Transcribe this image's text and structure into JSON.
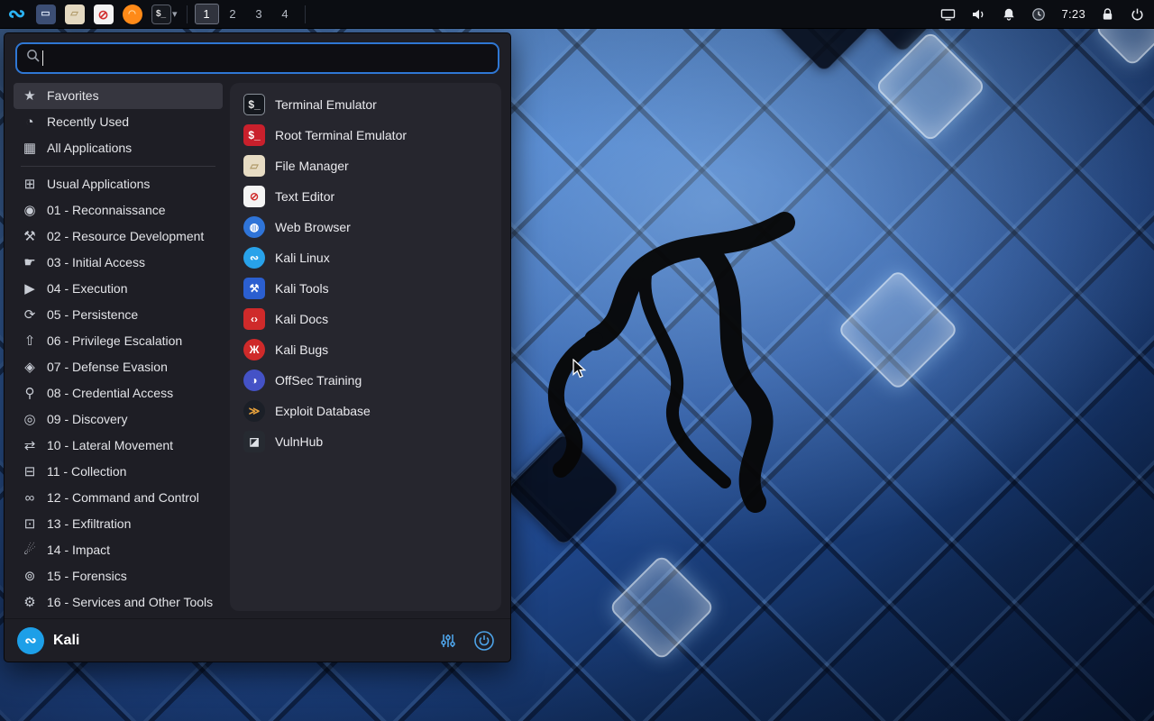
{
  "colors": {
    "accent": "#2f77d4",
    "panel_bg": "#0b0d12",
    "menu_bg": "#1e1e25",
    "kali_blue": "#1d9fe8"
  },
  "panel": {
    "launchers": [
      {
        "name": "whisker-menu-button",
        "glyph": "∾",
        "fg": "#2bb3f3",
        "size": "24px"
      },
      {
        "name": "window-manager-launcher",
        "glyph": "▭",
        "bg": "#3c4e74",
        "fg": "#d6e0f2",
        "size": "11px"
      },
      {
        "name": "file-manager-launcher",
        "glyph": "▱",
        "bg": "#e4d9c1",
        "fg": "#b29c6c",
        "size": "11px"
      },
      {
        "name": "text-editor-launcher",
        "glyph": "⊘",
        "bg": "#f3f3f3",
        "fg": "#d22f2f",
        "size": "14px"
      },
      {
        "name": "firefox-launcher",
        "glyph": "◠",
        "bg": "#ff8a18",
        "fg": "#ffd9a0",
        "size": "10px",
        "shape": "circle"
      },
      {
        "name": "terminal-launcher",
        "glyph": "$_",
        "bg": "#16191f",
        "fg": "#e4e4e4",
        "size": "10px",
        "border": "1px solid #5a5f6a"
      }
    ],
    "dropdown_glyph": "▾",
    "workspaces": [
      {
        "label": "1",
        "active": true
      },
      {
        "label": "2"
      },
      {
        "label": "3"
      },
      {
        "label": "4"
      }
    ],
    "tray_icons": [
      "display-icon",
      "volume-icon",
      "notifications-icon",
      "status-icon",
      "lock-icon",
      "logout-icon"
    ],
    "clock": "7:23"
  },
  "menu": {
    "search": {
      "value": "",
      "placeholder": ""
    },
    "categories": [
      {
        "label": "Favorites",
        "glyph": "★",
        "active": true
      },
      {
        "label": "Recently Used",
        "glyph": "◔"
      },
      {
        "label": "All Applications",
        "glyph": "▦"
      },
      {
        "divider": true
      },
      {
        "label": "Usual Applications",
        "glyph": "⊞"
      },
      {
        "label": "01 - Reconnaissance",
        "glyph": "◉"
      },
      {
        "label": "02 - Resource Development",
        "glyph": "⚒"
      },
      {
        "label": "03 - Initial Access",
        "glyph": "☛"
      },
      {
        "label": "04 - Execution",
        "glyph": "▶"
      },
      {
        "label": "05 - Persistence",
        "glyph": "⟳"
      },
      {
        "label": "06 - Privilege Escalation",
        "glyph": "⇧"
      },
      {
        "label": "07 - Defense Evasion",
        "glyph": "◈"
      },
      {
        "label": "08 - Credential Access",
        "glyph": "⚲"
      },
      {
        "label": "09 - Discovery",
        "glyph": "◎"
      },
      {
        "label": "10 - Lateral Movement",
        "glyph": "⇄"
      },
      {
        "label": "11 - Collection",
        "glyph": "⊟"
      },
      {
        "label": "12 - Command and Control",
        "glyph": "∞"
      },
      {
        "label": "13 - Exfiltration",
        "glyph": "⊡"
      },
      {
        "label": "14 - Impact",
        "glyph": "☄"
      },
      {
        "label": "15 - Forensics",
        "glyph": "⊚"
      },
      {
        "label": "16 - Services and Other Tools",
        "glyph": "⚙"
      }
    ],
    "apps": [
      {
        "label": "Terminal Emulator",
        "glyph": "$_",
        "bg": "#14171d",
        "fg": "#e6e6e6",
        "border": "1px solid #8a9099"
      },
      {
        "label": "Root Terminal Emulator",
        "glyph": "$_",
        "bg": "#c9202c",
        "fg": "#ffffff"
      },
      {
        "label": "File Manager",
        "glyph": "▱",
        "bg": "#e7dcc4",
        "fg": "#b09a6a"
      },
      {
        "label": "Text Editor",
        "glyph": "⊘",
        "bg": "#f4f4f4",
        "fg": "#cf2a2a"
      },
      {
        "label": "Web Browser",
        "glyph": "◍",
        "bg": "#2f74d8",
        "fg": "#ffffff",
        "shape": "circle"
      },
      {
        "label": "Kali Linux",
        "glyph": "∾",
        "bg": "#28a2ea",
        "fg": "#ffffff",
        "shape": "circle"
      },
      {
        "label": "Kali Tools",
        "glyph": "⚒",
        "bg": "#2b5fd0",
        "fg": "#ffffff"
      },
      {
        "label": "Kali Docs",
        "glyph": "‹›",
        "bg": "#cf2a2a",
        "fg": "#ffffff"
      },
      {
        "label": "Kali Bugs",
        "glyph": "Ж",
        "bg": "#cf2a2a",
        "fg": "#ffffff",
        "shape": "circle"
      },
      {
        "label": "OffSec Training",
        "glyph": "◑",
        "bg": "#4452c6",
        "fg": "#ffffff",
        "shape": "circle"
      },
      {
        "label": "Exploit Database",
        "glyph": "≫",
        "bg": "#1b1f27",
        "fg": "#e8a23c",
        "shape": "circle"
      },
      {
        "label": "VulnHub",
        "glyph": "◪",
        "bg": "#262a31",
        "fg": "#dfe3e8"
      }
    ],
    "footer": {
      "user": "Kali",
      "logo_glyph": "∾"
    }
  }
}
